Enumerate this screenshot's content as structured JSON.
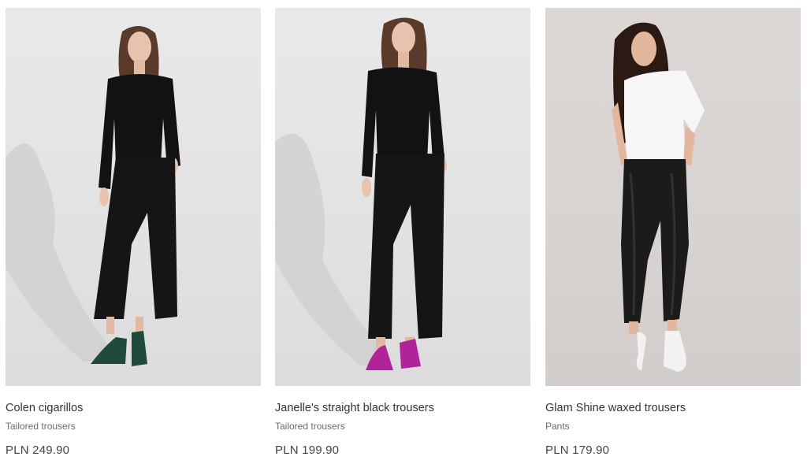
{
  "products": [
    {
      "name": "Colen cigarillos",
      "category": "Tailored trousers",
      "price": "PLN 249.90",
      "shoe_color": "#1f4a3c"
    },
    {
      "name": "Janelle's straight black trousers",
      "category": "Tailored trousers",
      "price": "PLN 199.90",
      "shoe_color": "#b1239a"
    },
    {
      "name": "Glam Shine waxed trousers",
      "category": "Pants",
      "price": "PLN 179.90",
      "shoe_color": "#f2f2f2"
    }
  ]
}
